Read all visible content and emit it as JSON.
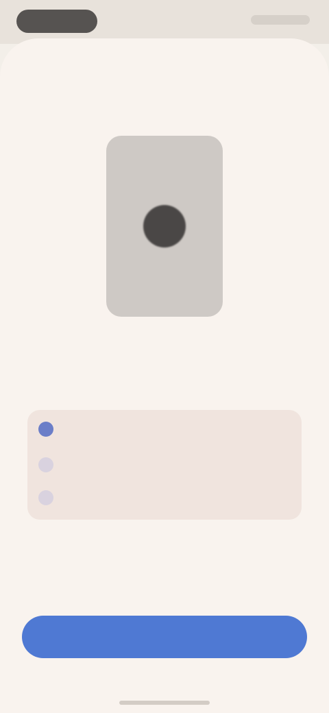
{
  "status_bar": {
    "time": ""
  },
  "content": {
    "title": "",
    "subtitle": ""
  },
  "options": {
    "items": [
      {
        "label": "",
        "selected": true
      },
      {
        "label": "",
        "selected": false
      },
      {
        "label": "",
        "selected": false
      }
    ]
  },
  "action": {
    "primary_label": ""
  },
  "colors": {
    "background": "#f9f3ee",
    "status_bar": "#e8e2db",
    "card": "#cec9c5",
    "accent": "#4f79d3",
    "selected_bullet": "#6b7ec8"
  },
  "icons": {
    "card_center": "circle-icon"
  }
}
